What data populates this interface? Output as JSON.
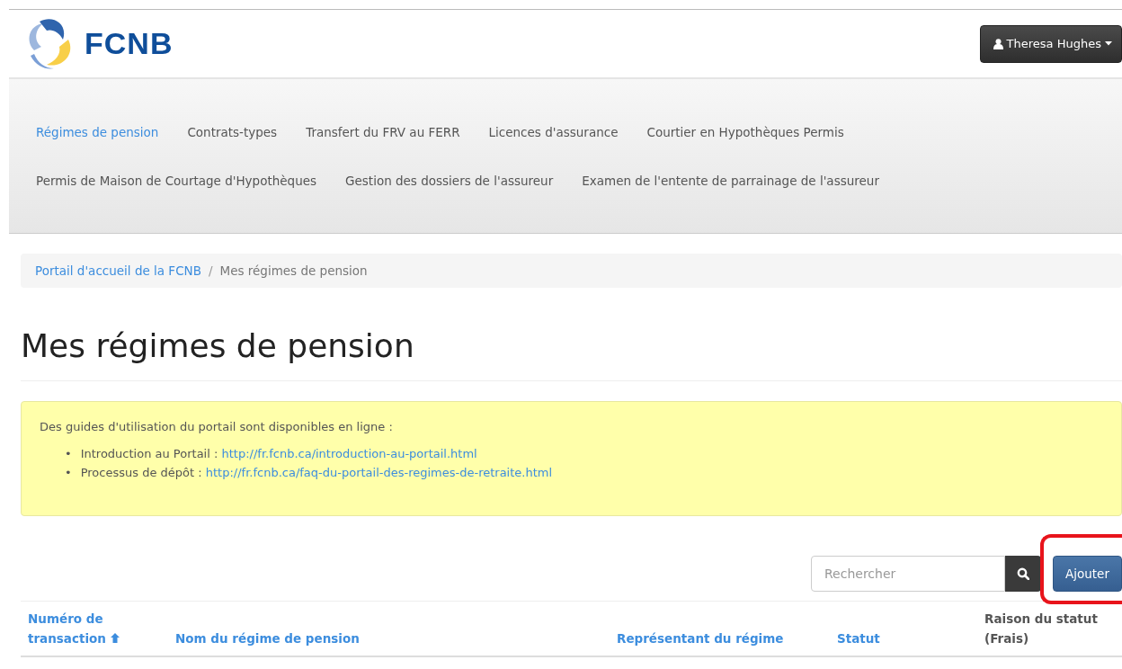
{
  "logo": {
    "text": "FCNB"
  },
  "user_menu": {
    "label": "Theresa Hughes"
  },
  "nav": {
    "items": [
      {
        "label": "Régimes de pension",
        "selected": true
      },
      {
        "label": "Contrats-types",
        "selected": false
      },
      {
        "label": "Transfert du FRV au FERR",
        "selected": false
      },
      {
        "label": "Licences d'assurance",
        "selected": false
      },
      {
        "label": "Courtier en Hypothèques Permis",
        "selected": false
      },
      {
        "label": "Permis de Maison de Courtage d'Hypothèques",
        "selected": false
      },
      {
        "label": "Gestion des dossiers de l'assureur",
        "selected": false
      },
      {
        "label": "Examen de l'entente de parrainage de l'assureur",
        "selected": false
      }
    ]
  },
  "breadcrumb": [
    {
      "label": "Portail d'accueil de la FCNB",
      "kind": "link",
      "separator": "/"
    },
    {
      "label": "Mes régimes de pension",
      "kind": "current"
    }
  ],
  "page_title": "Mes régimes de pension",
  "notice": {
    "intro": "Des guides d'utilisation du portail sont disponibles en ligne :",
    "items": [
      {
        "bullet": "•",
        "label": "Introduction au Portail :",
        "url": "http://fr.fcnb.ca/introduction-au-portail.html"
      },
      {
        "bullet": "•",
        "label": "Processus de dépôt :",
        "url": "http://fr.fcnb.ca/faq-du-portail-des-regimes-de-retraite.html"
      }
    ]
  },
  "search": {
    "placeholder": "Rechercher"
  },
  "add_button": {
    "label": "Ajouter",
    "highlighted": true
  },
  "table": {
    "columns": [
      {
        "label": "Numéro de transaction",
        "kind": "sortable",
        "sorted": true
      },
      {
        "label": "Nom du régime de pension",
        "kind": "sortable",
        "sorted": false
      },
      {
        "label": "Représentant du régime",
        "kind": "sortable",
        "sorted": false
      },
      {
        "label": "Statut",
        "kind": "sortable",
        "sorted": false
      },
      {
        "label": "Raison du statut (Frais)",
        "kind": "plain"
      }
    ]
  }
}
